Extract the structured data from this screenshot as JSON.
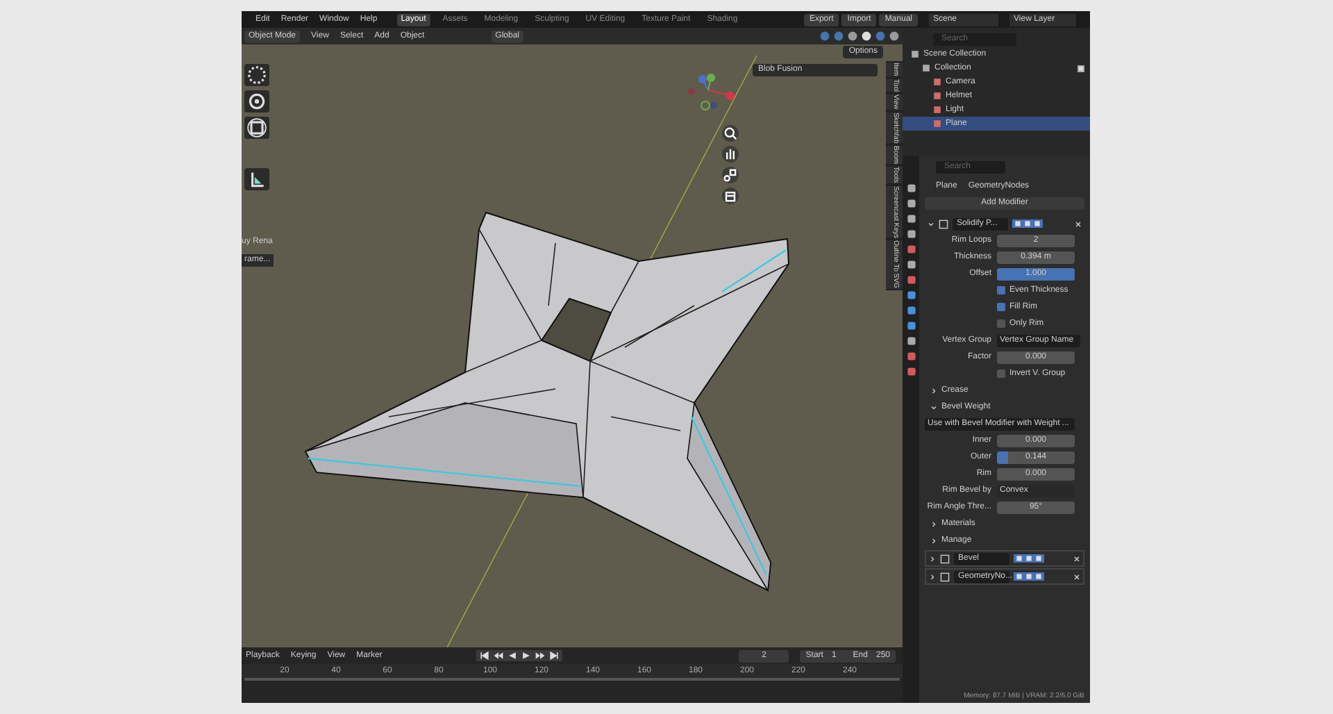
{
  "topbar": {
    "menus": [
      "Edit",
      "Render",
      "Window",
      "Help"
    ],
    "workspaces": [
      {
        "label": "Layout",
        "selected": true
      },
      {
        "label": "Assets",
        "selected": false
      },
      {
        "label": "Modeling",
        "selected": false
      },
      {
        "label": "Sculpting",
        "selected": false
      },
      {
        "label": "UV Editing",
        "selected": false
      },
      {
        "label": "Texture Paint",
        "selected": false
      },
      {
        "label": "Shading",
        "selected": false
      }
    ],
    "actions": [
      "Export",
      "Import",
      "Manual"
    ],
    "scene": "Scene",
    "view_layer": "View Layer"
  },
  "viewport_header": {
    "mode": "Object Mode",
    "menus": [
      "View",
      "Select",
      "Add",
      "Object"
    ],
    "orientation": "Global",
    "options": "Options"
  },
  "viewport": {
    "panel": "Blob Fusion",
    "side_tabs": [
      "Item",
      "Tool",
      "View",
      "Sketchfab",
      "Boom",
      "Tools",
      "Screencast Keys",
      "Outline To SVG"
    ],
    "cropped_texts": [
      "uy Rena",
      "rame..."
    ]
  },
  "outliner": {
    "search_placeholder": "Search",
    "items": [
      {
        "label": "Scene Collection",
        "children": [
          {
            "label": "Collection",
            "checked": true,
            "children": [
              {
                "label": "Camera",
                "selected": false
              },
              {
                "label": "Helmet",
                "selected": false
              },
              {
                "label": "Light",
                "selected": false
              },
              {
                "label": "Plane",
                "selected": true
              }
            ]
          }
        ]
      }
    ]
  },
  "properties": {
    "search_placeholder": "Search",
    "breadcrumb": [
      "Plane",
      "GeometryNodes"
    ],
    "add_modifier": "Add Modifier",
    "modifier": {
      "name": "Solidify P...",
      "expanded": true
    },
    "rows": [
      {
        "kind": "field",
        "label": "Rim Loops",
        "value": "2"
      },
      {
        "kind": "field",
        "label": "Thickness",
        "value": "0.394 m"
      },
      {
        "kind": "slider",
        "label": "Offset",
        "value": "1.000",
        "level": 1
      },
      {
        "kind": "check",
        "label": "Even Thickness",
        "checked": true
      },
      {
        "kind": "check",
        "label": "Fill Rim",
        "checked": true
      },
      {
        "kind": "check",
        "label": "Only Rim",
        "checked": false
      },
      {
        "kind": "text",
        "label": "Vertex Group",
        "value": "Vertex Group Name"
      },
      {
        "kind": "field",
        "label": "Factor",
        "value": "0.000"
      },
      {
        "kind": "check",
        "label": "Invert V. Group",
        "checked": false
      },
      {
        "kind": "section",
        "label": "Crease",
        "expanded": false
      },
      {
        "kind": "section",
        "label": "Bevel Weight",
        "expanded": true
      },
      {
        "kind": "note",
        "label": "Use with Bevel Modifier with Weight ..."
      },
      {
        "kind": "slider",
        "label": "Inner",
        "value": "0.000",
        "level": 0
      },
      {
        "kind": "slider",
        "label": "Outer",
        "value": "0.144",
        "level": 0.144
      },
      {
        "kind": "slider",
        "label": "Rim",
        "value": "0.000",
        "level": 0
      },
      {
        "kind": "dropdown",
        "label": "Rim Bevel by",
        "value": "Convex"
      },
      {
        "kind": "field",
        "label": "Rim Angle Thre...",
        "value": "95°"
      },
      {
        "kind": "section",
        "label": "Materials",
        "expanded": false
      },
      {
        "kind": "section",
        "label": "Manage",
        "expanded": false
      }
    ],
    "other_modifiers": [
      {
        "name": "Bevel",
        "expanded": false
      },
      {
        "name": "GeometryNo...",
        "expanded": false
      }
    ]
  },
  "timeline": {
    "menus": [
      "Playback",
      "Keying",
      "View",
      "Marker"
    ],
    "current_frame": "2",
    "start_label": "Start",
    "start": "1",
    "end_label": "End",
    "end": "250",
    "ticks": [
      "20",
      "40",
      "60",
      "80",
      "100",
      "120",
      "140",
      "160",
      "180",
      "200",
      "220",
      "240"
    ]
  },
  "status_bar": "Memory: 87.7 MiB | VRAM: 2.2/6.0 GiB"
}
